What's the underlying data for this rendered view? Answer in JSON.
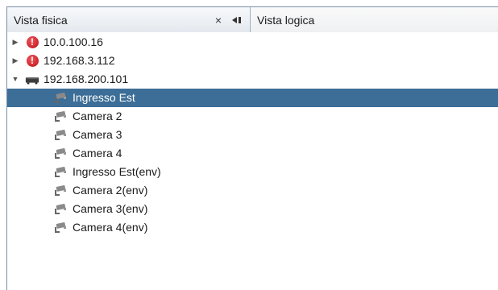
{
  "tabs": [
    {
      "label": "Vista fisica",
      "active": true
    },
    {
      "label": "Vista logica",
      "active": false
    }
  ],
  "tab_buttons": {
    "close": "×",
    "pin": "◀▮"
  },
  "tree": [
    {
      "label": "10.0.100.16",
      "level": 0,
      "icon": "error-icon",
      "expanded": false,
      "selected": false
    },
    {
      "label": "192.168.3.112",
      "level": 0,
      "icon": "error-icon",
      "expanded": false,
      "selected": false
    },
    {
      "label": "192.168.200.101",
      "level": 0,
      "icon": "recorder-icon",
      "expanded": true,
      "selected": false
    },
    {
      "label": "Ingresso Est",
      "level": 1,
      "icon": "camera-icon",
      "selected": true
    },
    {
      "label": "Camera 2",
      "level": 1,
      "icon": "camera-icon",
      "selected": false
    },
    {
      "label": "Camera 3",
      "level": 1,
      "icon": "camera-icon",
      "selected": false
    },
    {
      "label": "Camera 4",
      "level": 1,
      "icon": "camera-icon",
      "selected": false
    },
    {
      "label": "Ingresso Est(env)",
      "level": 1,
      "icon": "camera-icon",
      "selected": false
    },
    {
      "label": "Camera 2(env)",
      "level": 1,
      "icon": "camera-icon",
      "selected": false
    },
    {
      "label": "Camera 3(env)",
      "level": 1,
      "icon": "camera-icon",
      "selected": false
    },
    {
      "label": "Camera 4(env)",
      "level": 1,
      "icon": "camera-icon",
      "selected": false
    }
  ],
  "colors": {
    "selection": "#3c6e97",
    "error": "#d0262d",
    "border": "#7a8ea6"
  }
}
